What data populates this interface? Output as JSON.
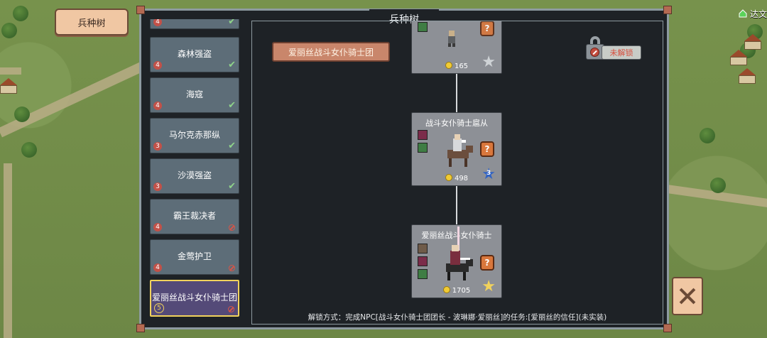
{
  "top_tab": {
    "label": "兵种树"
  },
  "top_right": {
    "label": "达文"
  },
  "panel": {
    "title": "兵种树"
  },
  "units": [
    {
      "name": "",
      "level": "4",
      "status": "unlocked"
    },
    {
      "name": "森林强盗",
      "level": "4",
      "status": "unlocked"
    },
    {
      "name": "海寇",
      "level": "4",
      "status": "unlocked"
    },
    {
      "name": "马尔克赤那纵",
      "level": "3",
      "status": "unlocked"
    },
    {
      "name": "沙漠强盗",
      "level": "3",
      "status": "unlocked"
    },
    {
      "name": "霸王裁决者",
      "level": "4",
      "status": "locked"
    },
    {
      "name": "金莺护卫",
      "level": "4",
      "status": "locked"
    },
    {
      "name": "爱丽丝战斗女仆骑士团",
      "level": "5",
      "status": "locked",
      "selected": true
    }
  ],
  "tree": {
    "title": "爱丽丝战斗女仆骑士团",
    "lock_label": "未解锁",
    "cards": [
      {
        "name": "",
        "cost": "165",
        "tier": ""
      },
      {
        "name": "战斗女仆骑士扈从",
        "cost": "498",
        "tier": "3"
      },
      {
        "name": "爱丽丝战斗女仆骑士",
        "cost": "1705",
        "tier": ""
      }
    ],
    "unlock_text": "解锁方式：完成NPC[战斗女仆骑士团团长 - 波琳娜·爱丽丝]的任务:[爱丽丝的信任](未实装)"
  },
  "colors": {
    "panel_bg": "#1e2226",
    "accent_plate": "#c9866b",
    "locked_red": "#d84d3c",
    "selected_border": "#f1d25c"
  }
}
